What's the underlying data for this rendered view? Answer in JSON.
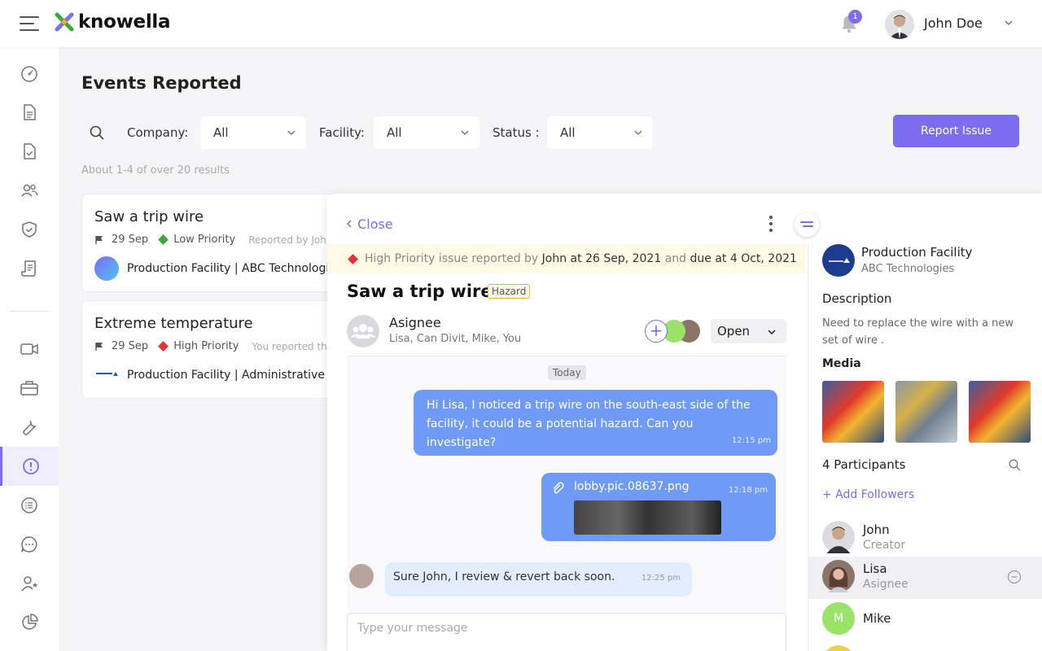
{
  "header": {
    "logo_text": "knowella",
    "notification_count": "1",
    "user_name": "John Doe"
  },
  "page": {
    "title": "Events Reported",
    "result_count": "About 1-4 of over 20 results"
  },
  "filters": {
    "company_label": "Company:",
    "company_value": "All",
    "facility_label": "Facility:",
    "facility_value": "All",
    "status_label": "Status :",
    "status_value": "All"
  },
  "report_button": "Report Issue",
  "events": [
    {
      "title": "Saw a trip wire",
      "date": "29 Sep",
      "priority": "Low Priority",
      "priority_color": "#3aa83a",
      "reported": "Reported by John",
      "facility": "Production Facility | ABC Technologies"
    },
    {
      "title": "Extreme temperature",
      "date": "29 Sep",
      "priority": "High Priority",
      "priority_color": "#e8303a",
      "reported": "You reported this",
      "facility": "Production Facility | Administrative Office"
    }
  ],
  "detail": {
    "close_label": "Close",
    "banner": {
      "prefix": "High Priority issue reported by",
      "reporter": "John at 26 Sep, 2021",
      "and": "and",
      "due": "due at 4 Oct, 2021"
    },
    "title": "Saw a trip wire",
    "tag": "Hazard",
    "assignee_label": "Asignee",
    "assignee_names": "Lisa, Can Divit, Mike, You",
    "status": "Open",
    "today_label": "Today",
    "messages": [
      {
        "text": "Hi Lisa, I noticed a trip wire on the south-east side of the facility, it could be a potential hazard. Can you investigate?",
        "time": "12:15 pm"
      },
      {
        "file": "lobby.pic.08637.png",
        "time": "12:18 pm"
      },
      {
        "text": "Sure John, I review & revert back soon.",
        "time": "12:25 pm"
      }
    ],
    "input_placeholder": "Type your message"
  },
  "info": {
    "facility_name": "Production Facility",
    "company": "ABC Technologies",
    "description_title": "Description",
    "description": "Need to replace the wire with a new set of wire .",
    "media_title": "Media",
    "participants_title": "4 Participants",
    "add_followers": "+ Add Followers",
    "participants": [
      {
        "name": "John",
        "role": "Creator"
      },
      {
        "name": "Lisa",
        "role": "Asignee"
      },
      {
        "name": "Mike",
        "role": "",
        "initial": "M"
      }
    ]
  },
  "colors": {
    "accent": "#7c6cf0",
    "bubble": "#6f9bf7",
    "high_priority": "#e8303a",
    "low_priority": "#3aa83a"
  }
}
